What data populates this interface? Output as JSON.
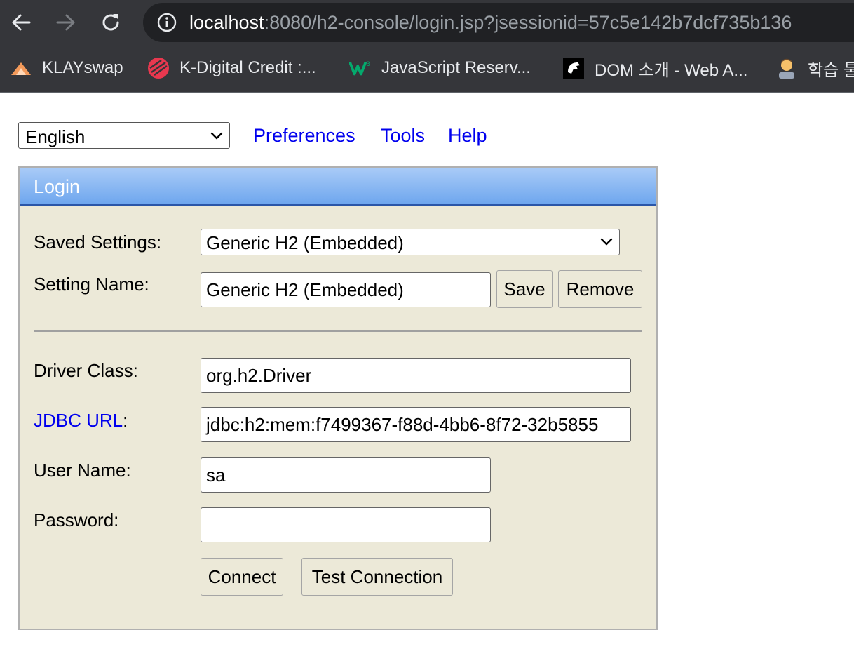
{
  "browser": {
    "url_host": "localhost",
    "url_rest": ":8080/h2-console/login.jsp?jsessionid=57c5e142b7dcf735b136",
    "bookmarks": [
      {
        "label": "KLAYswap",
        "icon": "klayswap-icon"
      },
      {
        "label": "K-Digital Credit :...",
        "icon": "k-digital-icon"
      },
      {
        "label": "JavaScript Reserv...",
        "icon": "w3-icon"
      },
      {
        "label": "DOM 소개 - Web A...",
        "icon": "mdn-icon"
      },
      {
        "label": "학습 툴",
        "icon": "student-icon"
      }
    ]
  },
  "topbar": {
    "language": "English",
    "links": [
      "Preferences",
      "Tools",
      "Help"
    ]
  },
  "login": {
    "title": "Login",
    "saved_settings_label": "Saved Settings:",
    "saved_settings_value": "Generic H2 (Embedded)",
    "setting_name_label": "Setting Name:",
    "setting_name_value": "Generic H2 (Embedded)",
    "save_label": "Save",
    "remove_label": "Remove",
    "driver_class_label": "Driver Class:",
    "driver_class_value": "org.h2.Driver",
    "jdbc_url_link": "JDBC URL",
    "jdbc_url_colon": ":",
    "jdbc_url_value": "jdbc:h2:mem:f7499367-f88d-4bb6-8f72-32b5855",
    "user_name_label": "User Name:",
    "user_name_value": "sa",
    "password_label": "Password:",
    "password_value": "",
    "connect_label": "Connect",
    "test_connection_label": "Test Connection"
  },
  "colors": {
    "chrome_bg": "#35363a",
    "panel_bg": "#ece9d8",
    "header_blue": "#6ea6ee",
    "link_blue": "#0000ee"
  }
}
